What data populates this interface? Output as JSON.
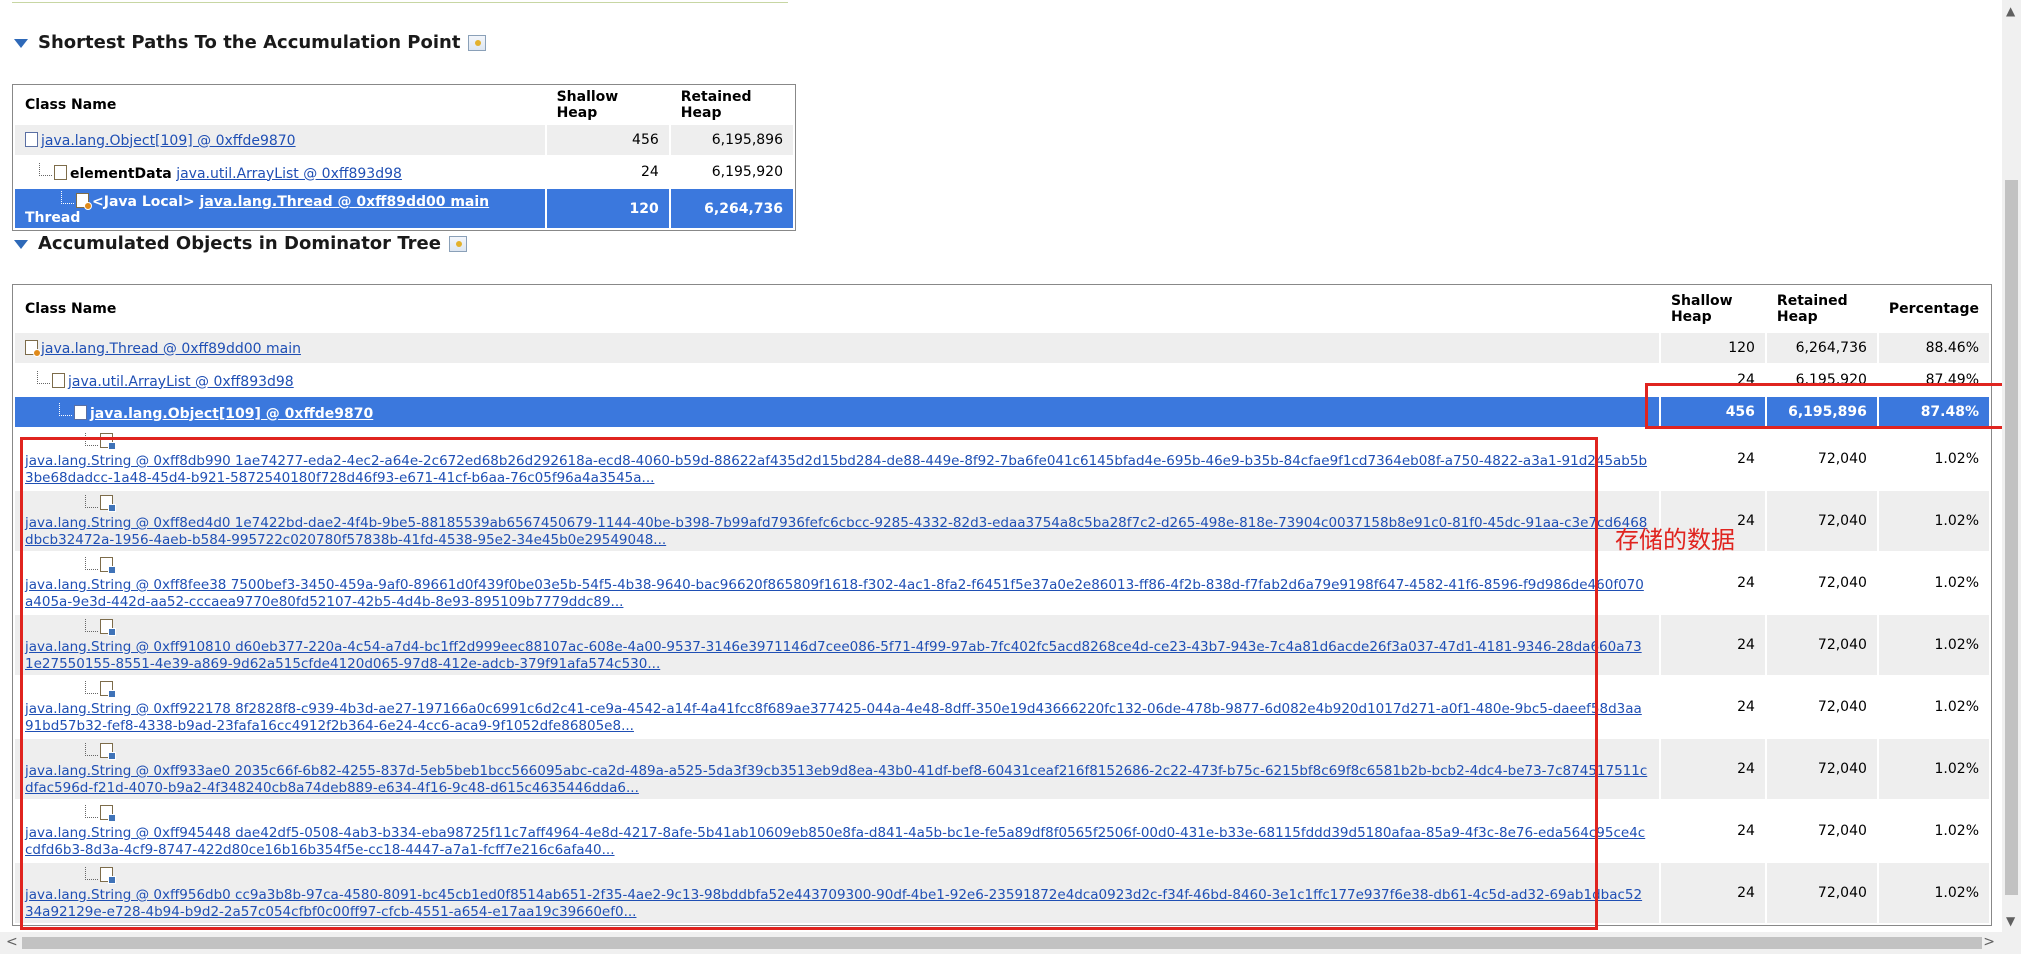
{
  "section1": {
    "title": "Shortest Paths To the Accumulation Point",
    "headers": [
      "Class Name",
      "Shallow Heap",
      "Retained Heap"
    ],
    "rows": [
      {
        "prefix": "",
        "link": "java.lang.Object[109] @ 0xffde9870",
        "suffix": "",
        "shallow": "456",
        "retained": "6,195,896"
      },
      {
        "prefix": "elementData",
        "link": "java.util.ArrayList @ 0xff893d98",
        "suffix": "",
        "shallow": "24",
        "retained": "6,195,920"
      },
      {
        "prefix": "<Java Local>",
        "link": "java.lang.Thread @ 0xff89dd00 main",
        "suffix": "Thread",
        "shallow": "120",
        "retained": "6,264,736"
      }
    ]
  },
  "section2": {
    "title": "Accumulated Objects in Dominator Tree",
    "headers": {
      "class": "Class Name",
      "shallow": "Shallow Heap",
      "retained": "Retained Heap",
      "percent": "Percentage"
    },
    "rows": [
      {
        "link": "java.lang.Thread @ 0xff89dd00 main",
        "shallow": "120",
        "retained": "6,264,736",
        "percent": "88.46%"
      },
      {
        "link": "java.util.ArrayList @ 0xff893d98",
        "shallow": "24",
        "retained": "6,195,920",
        "percent": "87.49%"
      },
      {
        "link": "java.lang.Object[109] @ 0xffde9870",
        "shallow": "456",
        "retained": "6,195,896",
        "percent": "87.48%"
      }
    ],
    "strings": [
      {
        "text": "java.lang.String @ 0xff8db990 1ae74277-eda2-4ec2-a64e-2c672ed68b26d292618a-ecd8-4060-b59d-88622af435d2d15bd284-de88-449e-8f92-7ba6fe041c6145bfad4e-695b-46e9-b35b-84cfae9f1cd7364eb08f-a750-4822-a3a1-91d245ab5b3be68dadcc-1a48-45d4-b921-5872540180f728d46f93-e671-41cf-b6aa-76c05f96a4a3545a...",
        "shallow": "24",
        "retained": "72,040",
        "percent": "1.02%"
      },
      {
        "text": "java.lang.String @ 0xff8ed4d0 1e7422bd-dae2-4f4b-9be5-88185539ab6567450679-1144-40be-b398-7b99afd7936fefc6cbcc-9285-4332-82d3-edaa3754a8c5ba28f7c2-d265-498e-818e-73904c0037158b8e91c0-81f0-45dc-91aa-c3e7cd6468dbcb32472a-1956-4aeb-b584-995722c020780f57838b-41fd-4538-95e2-34e45b0e29549048...",
        "shallow": "24",
        "retained": "72,040",
        "percent": "1.02%"
      },
      {
        "text": "java.lang.String @ 0xff8fee38 7500bef3-3450-459a-9af0-89661d0f439f0be03e5b-54f5-4b38-9640-bac96620f865809f1618-f302-4ac1-8fa2-f6451f5e37a0e2e86013-ff86-4f2b-838d-f7fab2d6a79e9198f647-4582-41f6-8596-f9d986de460f070a405a-9e3d-442d-aa52-cccaea9770e80fd52107-42b5-4d4b-8e93-895109b7779ddc89...",
        "shallow": "24",
        "retained": "72,040",
        "percent": "1.02%"
      },
      {
        "text": "java.lang.String @ 0xff910810 d60eb377-220a-4c54-a7d4-bc1ff2d999eec88107ac-608e-4a00-9537-3146e3971146d7cee086-5f71-4f99-97ab-7fc402fc5acd8268ce4d-ce23-43b7-943e-7c4a81d6acde26f3a037-47d1-4181-9346-28da660a731e27550155-8551-4e39-a869-9d62a515cfde4120d065-97d8-412e-adcb-379f91afa574c530...",
        "shallow": "24",
        "retained": "72,040",
        "percent": "1.02%"
      },
      {
        "text": "java.lang.String @ 0xff922178 8f2828f8-c939-4b3d-ae27-197166a0c6991c6d2c41-ce9a-4542-a14f-4a41fcc8f689ae377425-044a-4e48-8dff-350e19d43666220fc132-06de-478b-9877-6d082e4b920d1017d271-a0f1-480e-9bc5-daeef58d3aa91bd57b32-fef8-4338-b9ad-23fafa16cc4912f2b364-6e24-4cc6-aca9-9f1052dfe86805e8...",
        "shallow": "24",
        "retained": "72,040",
        "percent": "1.02%"
      },
      {
        "text": "java.lang.String @ 0xff933ae0 2035c66f-6b82-4255-837d-5eb5beb1bcc566095abc-ca2d-489a-a525-5da3f39cb3513eb9d8ea-43b0-41df-bef8-60431ceaf216f8152686-2c22-473f-b75c-6215bf8c69f8c6581b2b-bcb2-4dc4-be73-7c874517511cdfac596d-f21d-4070-b9a2-4f348240cb8a74deb889-e634-4f16-9c48-d615c4635446dda6...",
        "shallow": "24",
        "retained": "72,040",
        "percent": "1.02%"
      },
      {
        "text": "java.lang.String @ 0xff945448 dae42df5-0508-4ab3-b334-eba98725f11c7aff4964-4e8d-4217-8afe-5b41ab10609eb850e8fa-d841-4a5b-bc1e-fe5a89df8f0565f2506f-00d0-431e-b33e-68115fddd39d5180afaa-85a9-4f3c-8e76-eda564c95ce4ccdfd6b3-8d3a-4cf9-8747-422d80ce16b16b354f5e-cc18-4447-a7a1-fcff7e216c6afa40...",
        "shallow": "24",
        "retained": "72,040",
        "percent": "1.02%"
      },
      {
        "text": "java.lang.String @ 0xff956db0 cc9a3b8b-97ca-4580-8091-bc45cb1ed0f8514ab651-2f35-4ae2-9c13-98bddbfa52e443709300-90df-4be1-92e6-23591872e4dca0923d2c-f34f-46bd-8460-3e1c1ffc177e937f6e38-db61-4c5d-ad32-69ab1dbac5234a92129e-e728-4b94-b9d2-2a57c054cfbf0c00ff97-cfcb-4551-a654-e17aa19c39660ef0...",
        "shallow": "24",
        "retained": "72,040",
        "percent": "1.02%"
      }
    ]
  },
  "annotation": {
    "label": "存储的数据",
    "color": "#e0241f"
  },
  "colors": {
    "selection": "#3b78dd",
    "link": "#1f4fb4",
    "alt_row": "#eeeeee"
  }
}
